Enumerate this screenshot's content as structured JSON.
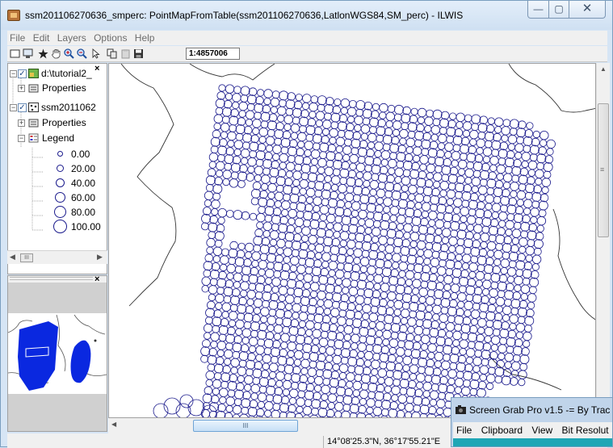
{
  "window": {
    "title": "ssm201106270636_smperc: PointMapFromTable(ssm201106270636,LatlonWGS84,SM_perc) - ILWIS",
    "min_glyph": "—",
    "max_glyph": "▢",
    "close_glyph": "✕"
  },
  "menubar": {
    "items": [
      "File",
      "Edit",
      "Layers",
      "Options",
      "Help"
    ]
  },
  "toolbar": {
    "icons": [
      "new-map-icon",
      "print-icon",
      "select-star-icon",
      "pan-hand-icon",
      "zoom-in-icon",
      "zoom-out-icon",
      "pointer-icon",
      "copy-icon",
      "paste-icon",
      "save-icon"
    ],
    "scale": "1:4857006"
  },
  "tree": {
    "layer1": {
      "label": "d:\\tutorial2_",
      "checked": true,
      "expander": "−",
      "props": "Properties"
    },
    "layer2": {
      "label": "ssm2011062",
      "checked": true,
      "expander": "−",
      "props": "Properties",
      "legend": "Legend"
    },
    "legend_items": [
      "0.00",
      "20.00",
      "40.00",
      "60.00",
      "80.00",
      "100.00"
    ],
    "close_glyph": "×"
  },
  "overview": {
    "close_glyph": "×"
  },
  "map": {
    "point_color": "#1a1a8c",
    "boundary_color": "#333333"
  },
  "scrollbars": {
    "thumb_grip": "III",
    "vgrip": "≡"
  },
  "statusbar": {
    "coordinates": "14°08'25.3\"N, 36°17'55.21\"E"
  },
  "screen_grab": {
    "title": "Screen Grab Pro v1.5  -= By Trac",
    "menu": [
      "File",
      "Clipboard",
      "View",
      "Bit Resolut"
    ],
    "accent": "#1fa6b5"
  }
}
